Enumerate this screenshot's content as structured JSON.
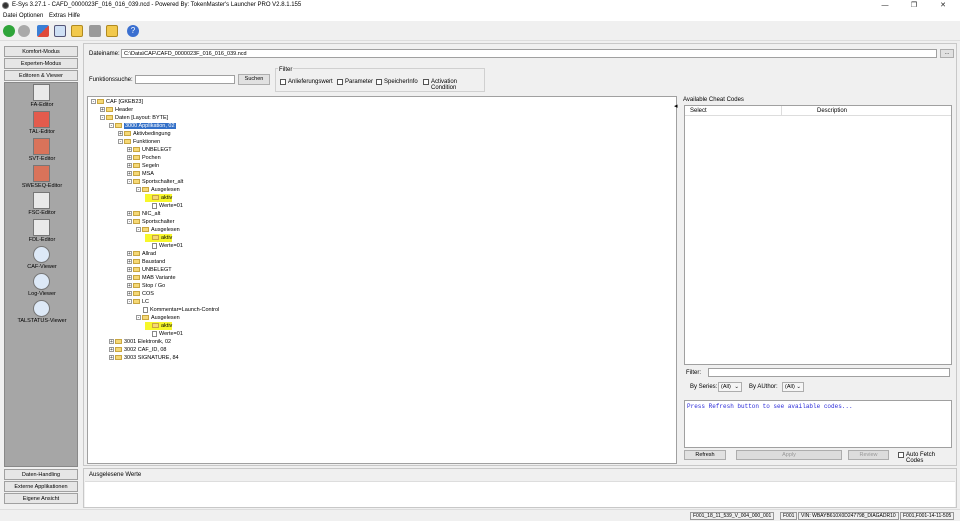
{
  "window": {
    "title": "E-Sys 3.27.1 - CAFD_0000023F_016_016_039.ncd  -  Powered By: TokenMaster's Launcher PRO V2.8.1.155"
  },
  "menu": [
    "Datei",
    "Optionen",
    "Extras",
    "Hilfe"
  ],
  "left_nav": {
    "top_buttons": [
      "Komfort-Modus",
      "Experten-Modus",
      "Editoren & Viewer"
    ],
    "tools": [
      "FA-Editor",
      "TAL-Editor",
      "SVT-Editor",
      "SWESEQ-Editor",
      "FSC-Editor",
      "FDL-Editor",
      "CAF-Viewer",
      "Log-Viewer",
      "TALSTATUS-Viewer"
    ],
    "bottom_buttons": [
      "Daten-Handling",
      "Externe Applikationen",
      "Eigene Ansicht"
    ]
  },
  "file": {
    "label": "Dateiname:",
    "value": "C:\\Data\\CAF\\CAFD_0000023F_016_016_039.ncd",
    "browse": "..."
  },
  "search": {
    "label": "Funktionssuche:",
    "value": "",
    "button": "Suchen"
  },
  "filter": {
    "title": "Filter",
    "options": [
      "Anlieferungswert",
      "Parameter",
      "SpeicherInfo",
      "Activation Condition"
    ]
  },
  "tree": [
    {
      "label": "CAF [GKEB23]",
      "level": 0,
      "type": "folder",
      "exp": "-"
    },
    {
      "label": "Header",
      "level": 1,
      "type": "folder",
      "exp": "+"
    },
    {
      "label": "Daten [Layout: BYTE]",
      "level": 1,
      "type": "folder",
      "exp": "-"
    },
    {
      "label": "3000 Applikation, 02",
      "level": 2,
      "type": "folder",
      "exp": "-",
      "selected": true
    },
    {
      "label": "Aktivbedingung",
      "level": 3,
      "type": "folder",
      "exp": "+"
    },
    {
      "label": "Funktionen",
      "level": 3,
      "type": "folder",
      "exp": "-"
    },
    {
      "label": "UNBELEGT",
      "level": 4,
      "type": "folder",
      "exp": "+"
    },
    {
      "label": "Pochen",
      "level": 4,
      "type": "folder",
      "exp": "+"
    },
    {
      "label": "Segeln",
      "level": 4,
      "type": "folder",
      "exp": "+"
    },
    {
      "label": "MSA",
      "level": 4,
      "type": "folder",
      "exp": "+"
    },
    {
      "label": "Sportschalter_alt",
      "level": 4,
      "type": "folder",
      "exp": "-"
    },
    {
      "label": "Ausgelesen",
      "level": 5,
      "type": "folder",
      "exp": "-"
    },
    {
      "label": "aktiv",
      "level": 6,
      "type": "folder",
      "exp": "",
      "highlight": true
    },
    {
      "label": "Werte=01",
      "level": 6,
      "type": "doc",
      "exp": ""
    },
    {
      "label": "NIC_alt",
      "level": 4,
      "type": "folder",
      "exp": "+"
    },
    {
      "label": "Sportschalter",
      "level": 4,
      "type": "folder",
      "exp": "-"
    },
    {
      "label": "Ausgelesen",
      "level": 5,
      "type": "folder",
      "exp": "-"
    },
    {
      "label": "aktiv",
      "level": 6,
      "type": "folder",
      "exp": "",
      "highlight": true
    },
    {
      "label": "Werte=01",
      "level": 6,
      "type": "doc",
      "exp": ""
    },
    {
      "label": "Allrad",
      "level": 4,
      "type": "folder",
      "exp": "+"
    },
    {
      "label": "Baustand",
      "level": 4,
      "type": "folder",
      "exp": "+"
    },
    {
      "label": "UNBELEGT",
      "level": 4,
      "type": "folder",
      "exp": "+"
    },
    {
      "label": "MAB Variante",
      "level": 4,
      "type": "folder",
      "exp": "+"
    },
    {
      "label": "Stop / Go",
      "level": 4,
      "type": "folder",
      "exp": "+"
    },
    {
      "label": "COS",
      "level": 4,
      "type": "folder",
      "exp": "+"
    },
    {
      "label": "LC",
      "level": 4,
      "type": "folder",
      "exp": "-"
    },
    {
      "label": "Kommentar=Launch-Control",
      "level": 5,
      "type": "doc",
      "exp": ""
    },
    {
      "label": "Ausgelesen",
      "level": 5,
      "type": "folder",
      "exp": "-"
    },
    {
      "label": "aktiv",
      "level": 6,
      "type": "folder",
      "exp": "",
      "highlight": true
    },
    {
      "label": "Werte=01",
      "level": 6,
      "type": "doc",
      "exp": ""
    },
    {
      "label": "3001 Elektronik, 02",
      "level": 2,
      "type": "folder",
      "exp": "+"
    },
    {
      "label": "3002 CAF_ID, 08",
      "level": 2,
      "type": "folder",
      "exp": "+"
    },
    {
      "label": "3003 SIGNATURE, 84",
      "level": 2,
      "type": "folder",
      "exp": "+"
    }
  ],
  "cheat": {
    "title": "Available Cheat Codes",
    "col_select": "Select",
    "col_description": "Description",
    "filter_label": "Filter:",
    "filter_value": "",
    "by_series_label": "By Series:",
    "by_series_value": "(All)",
    "by_author_label": "By AUthor:",
    "by_author_value": "(All)",
    "message": "Press Refresh button to see available codes...",
    "refresh": "Refresh",
    "apply": "Apply",
    "review": "Review",
    "autofetch": "Auto Fetch Codes"
  },
  "bottom": {
    "title": "Ausgelesene Werte"
  },
  "status": [
    "F001_18_11_539_V_004_000_001",
    "F001",
    "VIN: WBAYB610X0D247798_DIAGADR10",
    "F001,F001-14-11-505"
  ],
  "colors": {
    "highlight": "#f7f72a",
    "selection": "#3370c8",
    "message_text": "#2a2ad8",
    "editor_panel": "#a6a6a6"
  }
}
